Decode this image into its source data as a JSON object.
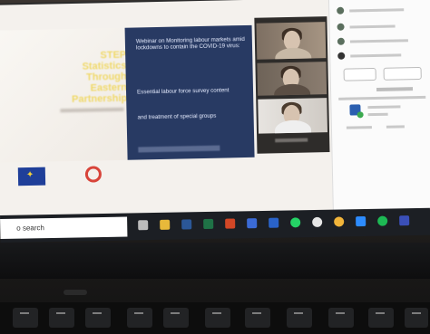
{
  "slide_left": {
    "title_lines": [
      "STEP",
      "Statistics",
      "Through",
      "Eastern",
      "Partnership"
    ]
  },
  "slide_main": {
    "line1": "Webinar on Monitoring labour markets amid lockdowns to contain the COVID-19 virus:",
    "line2": "Essential labour force survey content",
    "line3": "and treatment of special groups"
  },
  "taskbar": {
    "search_text": "o search"
  },
  "colors": {
    "slide_blue": "#283a63",
    "step_yellow": "#f0d96a",
    "taskbar": "#1c1f24"
  }
}
